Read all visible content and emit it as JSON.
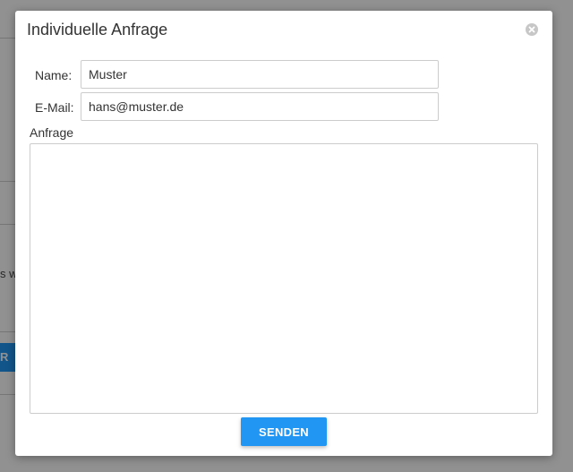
{
  "background": {
    "partial_text": "s w",
    "partial_button": "R"
  },
  "modal": {
    "title": "Individuelle Anfrage",
    "close_icon": "close-circle-icon"
  },
  "form": {
    "name_label": "Name:",
    "name_value": "Muster",
    "email_label": "E-Mail:",
    "email_value": "hans@muster.de",
    "message_label": "Anfrage",
    "message_value": "",
    "submit_label": "SENDEN"
  },
  "colors": {
    "accent": "#2196f3",
    "overlay": "rgba(0,0,0,0.43)"
  }
}
